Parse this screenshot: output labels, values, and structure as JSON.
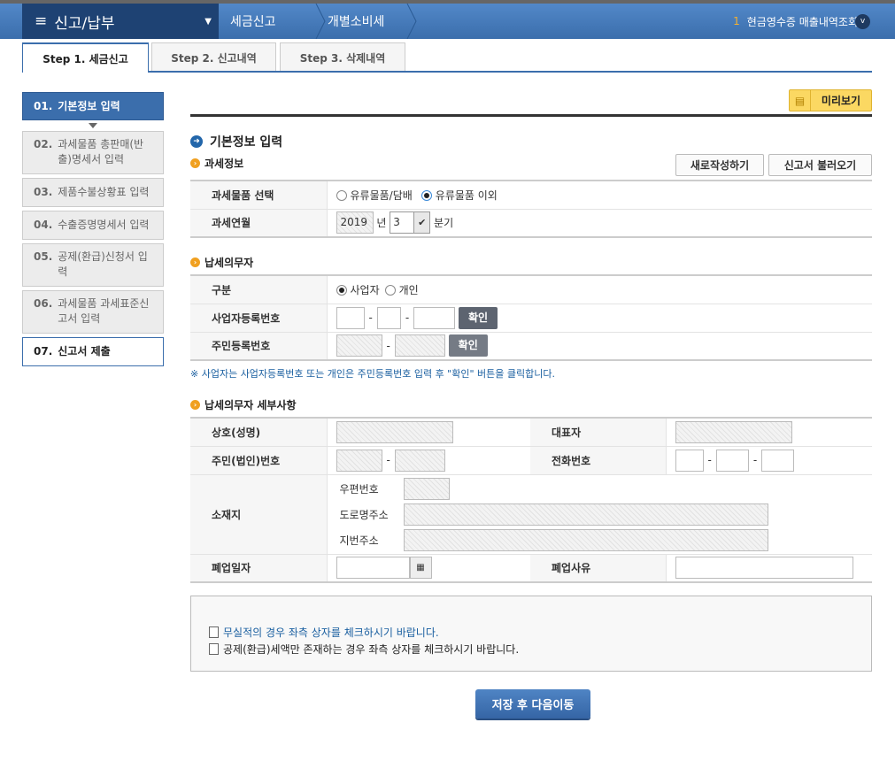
{
  "header": {
    "menu": "신고/납부",
    "breadcrumbs": [
      "세금신고",
      "개별소비세"
    ],
    "recent_num": "1",
    "recent_label": "현금영수증 매출내역조회"
  },
  "tabs": [
    "Step 1. 세금신고",
    "Step 2. 신고내역",
    "Step 3. 삭제내역"
  ],
  "sidebar": [
    {
      "num": "01.",
      "label": "기본정보 입력"
    },
    {
      "num": "02.",
      "label": "과세물품 총판매(반출)명세서 입력"
    },
    {
      "num": "03.",
      "label": "제품수불상황표 입력"
    },
    {
      "num": "04.",
      "label": "수출증명명세서 입력"
    },
    {
      "num": "05.",
      "label": "공제(환급)신청서 입력"
    },
    {
      "num": "06.",
      "label": "과세물품 과세표준신고서 입력"
    },
    {
      "num": "07.",
      "label": "신고서 제출"
    }
  ],
  "toolbar": {
    "preview": "미리보기",
    "new": "새로작성하기",
    "load": "신고서 불러오기"
  },
  "title": "기본정보 입력",
  "tax_info": {
    "heading": "과세정보",
    "item_label": "과세물품 선택",
    "opt1": "유류물품/담배",
    "opt2": "유류물품 이외",
    "period_label": "과세연월",
    "year": "2019",
    "year_unit": "년",
    "quarter": "3",
    "quarter_unit": "분기"
  },
  "taxpayer": {
    "heading": "납세의무자",
    "type_label": "구분",
    "opt1": "사업자",
    "opt2": "개인",
    "brn_label": "사업자등록번호",
    "rrn_label": "주민등록번호",
    "confirm": "확인",
    "note": "※ 사업자는 사업자등록번호 또는 개인은 주민등록번호 입력 후 \"확인\" 버튼을 클릭합니다."
  },
  "details": {
    "heading": "납세의무자 세부사항",
    "name": "상호(성명)",
    "rep": "대표자",
    "id": "주민(법인)번호",
    "phone": "전화번호",
    "addr": "소재지",
    "zip": "우편번호",
    "road": "도로명주소",
    "lot": "지번주소",
    "close_date": "폐업일자",
    "close_reason": "폐업사유"
  },
  "checks": [
    "무실적의 경우 좌측 상자를 체크하시기 바랍니다.",
    "공제(환급)세액만 존재하는 경우 좌측 상자를 체크하시기 바랍니다."
  ],
  "save": "저장 후 다음이동"
}
